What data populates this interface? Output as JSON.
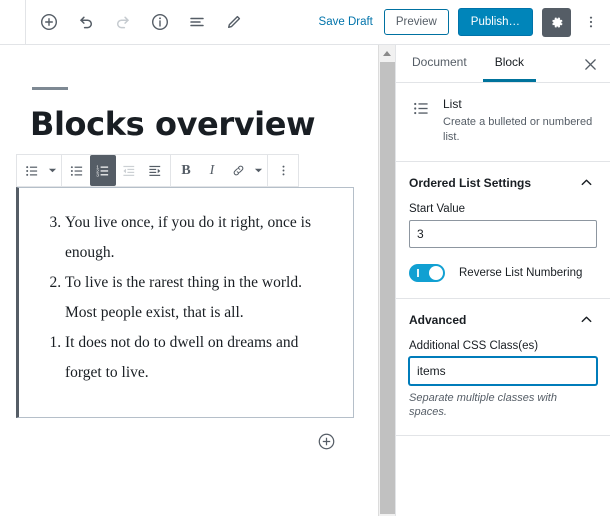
{
  "topbar": {
    "tools": [
      {
        "name": "add-block-icon",
        "label": "Add block",
        "disabled": false
      },
      {
        "name": "undo-icon",
        "label": "Undo",
        "disabled": false
      },
      {
        "name": "redo-icon",
        "label": "Redo",
        "disabled": true
      },
      {
        "name": "info-icon",
        "label": "Content structure",
        "disabled": false
      },
      {
        "name": "block-navigation-icon",
        "label": "Block navigation",
        "disabled": false
      },
      {
        "name": "edit-pencil-icon",
        "label": "Edit",
        "disabled": false
      }
    ],
    "save_draft_label": "Save Draft",
    "preview_label": "Preview",
    "publish_label": "Publish…",
    "settings_gear_label": "Settings",
    "more_options_label": "More tools & options"
  },
  "editor": {
    "post_title": "Blocks overview",
    "block_toolbar": {
      "block_type_label": "List",
      "unordered_list_label": "Convert to unordered list",
      "ordered_list_label": "Convert to ordered list",
      "outdent_label": "Outdent list item",
      "indent_label": "Indent list item",
      "bold_label": "B",
      "italic_label": "I",
      "link_label": "Link",
      "more_rich_text_label": "More rich text controls",
      "more_options_label": "More options"
    },
    "list_block": {
      "ordered": true,
      "reversed": true,
      "start": 3,
      "items": [
        "You live once, if you do it right, once is enough.",
        "To live is the rarest thing in the world. Most people exist, that is all.",
        "It does not do to dwell on dreams and forget to live."
      ]
    },
    "add_block_label": "Add block"
  },
  "sidebar": {
    "tabs": [
      {
        "label": "Document",
        "active": false
      },
      {
        "label": "Block",
        "active": true
      }
    ],
    "close_label": "×",
    "block_card": {
      "icon": "list-icon",
      "title": "List",
      "description": "Create a bulleted or numbered list."
    },
    "panels": [
      {
        "title": "Ordered List Settings",
        "expanded": true,
        "start_value_label": "Start Value",
        "start_value": "3",
        "reverse_toggle_label": "Reverse List Numbering",
        "reverse_toggle_on": true
      },
      {
        "title": "Advanced",
        "expanded": true,
        "css_class_label": "Additional CSS Class(es)",
        "css_class_value": "items",
        "css_class_help": "Separate multiple classes with spaces."
      }
    ]
  },
  "colors": {
    "accent_blue": "#0085ba",
    "link_blue": "#0073aa",
    "toggle_on": "#11a0d2",
    "focus_blue": "#007cba",
    "toolbar_dark": "#555d66",
    "border_gray": "#e2e4e7"
  },
  "scrollbar": {
    "name": "editor-vertical-scrollbar"
  }
}
